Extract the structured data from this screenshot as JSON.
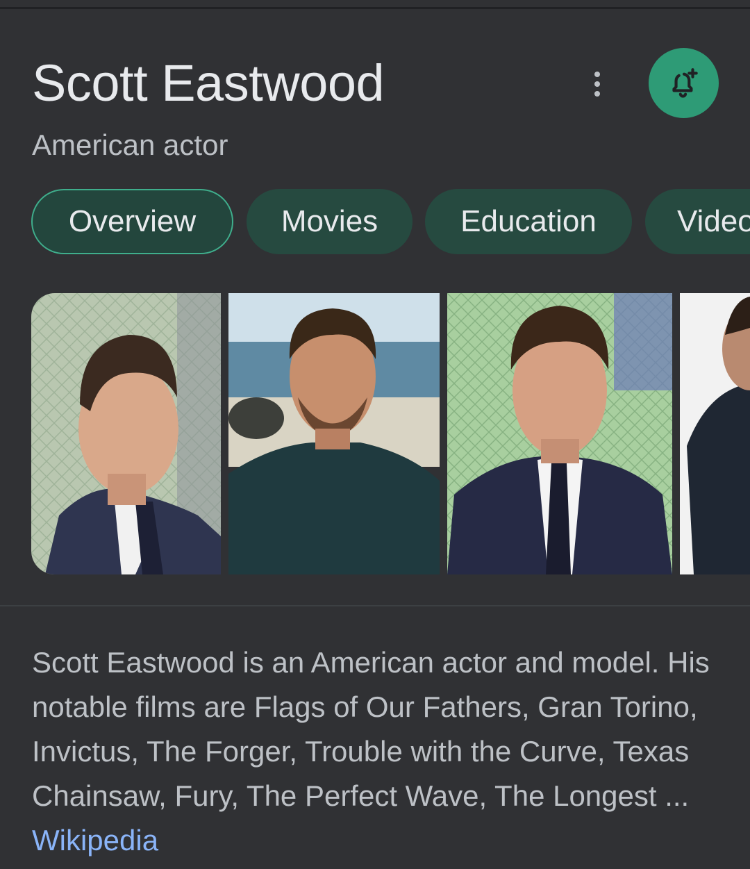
{
  "entity": {
    "title": "Scott Eastwood",
    "subtitle": "American actor"
  },
  "actions": {
    "more_icon": "more-vert-icon",
    "follow_icon": "bell-plus-icon",
    "follow_color": "#2e9b76"
  },
  "tabs": [
    {
      "label": "Overview",
      "active": true
    },
    {
      "label": "Movies",
      "active": false
    },
    {
      "label": "Education",
      "active": false
    },
    {
      "label": "Videos",
      "active": false
    }
  ],
  "images": [
    {
      "subject": "portrait-suit-event"
    },
    {
      "subject": "portrait-beach-tshirt"
    },
    {
      "subject": "portrait-suit-premiere"
    },
    {
      "subject": "portrait-partial"
    }
  ],
  "description": {
    "text": "Scott Eastwood is an American actor and model. His notable films are Flags of Our Fathers, Gran Torino, Invictus, The Forger, Trouble with the Curve, Texas Chainsaw, Fury, The Perfect Wave, The Longest ... ",
    "source_label": "Wikipedia"
  },
  "colors": {
    "background": "#303134",
    "tab_bg": "#264a40",
    "tab_active_border": "#3fae8c",
    "link": "#8ab4f8"
  }
}
